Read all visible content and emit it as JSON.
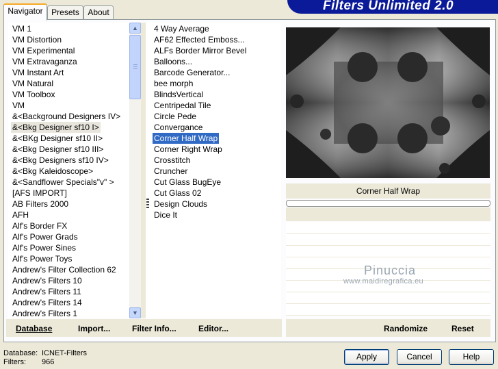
{
  "tabs": [
    "Navigator",
    "Presets",
    "About"
  ],
  "banner_title": "Filters Unlimited 2.0",
  "categories": [
    "VM 1",
    "VM Distortion",
    "VM Experimental",
    "VM Extravaganza",
    "VM Instant Art",
    "VM Natural",
    "VM Toolbox",
    "VM",
    "&<Background Designers IV>",
    "&<Bkg Designer sf10 I>",
    "&<BKg Designer sf10 II>",
    "&<Bkg Designer sf10 III>",
    "&<Bkg Designers sf10 IV>",
    "&<Bkg Kaleidoscope>",
    "&<Sandflower Specials\"v\" >",
    "[AFS IMPORT]",
    "AB Filters 2000",
    "AFH",
    "Alf's Border FX",
    "Alf's Power Grads",
    "Alf's Power Sines",
    "Alf's Power Toys",
    "Andrew's Filter Collection 62",
    "Andrew's Filters 10",
    "Andrew's Filters 11",
    "Andrew's Filters 14",
    "Andrew's Filters 1"
  ],
  "selected_category": "&<Bkg Designer sf10 I>",
  "filters": [
    "4 Way Average",
    "AF62 Effected Emboss...",
    "ALFs Border Mirror Bevel",
    "Balloons...",
    "Barcode Generator...",
    "bee morph",
    "BlindsVertical",
    "Centripedal Tile",
    "Circle Pede",
    "Convergance",
    "Corner Half Wrap",
    "Corner Right Wrap",
    "Crosstitch",
    "Cruncher",
    "Cut Glass  BugEye",
    "Cut Glass 02",
    "Design Clouds",
    "Dice It"
  ],
  "selected_filter": "Corner Half Wrap",
  "preview_caption": "Corner Half Wrap",
  "watermark": {
    "name": "Pinuccia",
    "url": "www.maidiregrafica.eu"
  },
  "actions": {
    "database": "Database",
    "import": "Import...",
    "filter_info": "Filter Info...",
    "editor": "Editor...",
    "randomize": "Randomize",
    "reset": "Reset"
  },
  "info": {
    "database_label": "Database:",
    "database_value": "ICNET-Filters",
    "filters_label": "Filters:",
    "filters_value": "966"
  },
  "buttons": {
    "apply": "Apply",
    "cancel": "Cancel",
    "help": "Help"
  },
  "colors": {
    "selection": "#316ac5",
    "banner": "#0b1a98",
    "tab_accent": "#f5a825"
  },
  "icons": {
    "scroll_up": "up-arrow-icon",
    "scroll_down": "down-arrow-icon"
  }
}
